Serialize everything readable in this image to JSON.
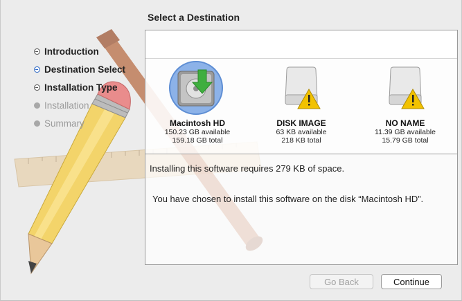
{
  "page": {
    "heading": "Select a Destination"
  },
  "sidebar": {
    "steps": [
      {
        "label": "Introduction",
        "state": "done"
      },
      {
        "label": "Destination Select",
        "state": "current"
      },
      {
        "label": "Installation Type",
        "state": "done"
      },
      {
        "label": "Installation",
        "state": "todo"
      },
      {
        "label": "Summary",
        "state": "todo"
      }
    ]
  },
  "disks": [
    {
      "name": "Macintosh HD",
      "available": "150.23 GB available",
      "total": "159.18 GB total",
      "selected": true,
      "icon": "internal-drive-icon"
    },
    {
      "name": "DISK IMAGE",
      "available": "63 KB available",
      "total": "218 KB total",
      "selected": false,
      "icon": "external-drive-warning-icon"
    },
    {
      "name": "NO NAME",
      "available": "11.39 GB available",
      "total": "15.79 GB total",
      "selected": false,
      "icon": "external-drive-warning-icon"
    }
  ],
  "info": {
    "requirement": "Installing this software requires 279 KB of space.",
    "choice": "You have chosen to install this software on the disk “Macintosh HD”."
  },
  "buttons": {
    "back": "Go Back",
    "continue": "Continue"
  },
  "colors": {
    "accent": "#2a66c4",
    "selection": "#8cb2e8",
    "warning": "#f2c200",
    "install_arrow": "#3fae3f"
  }
}
